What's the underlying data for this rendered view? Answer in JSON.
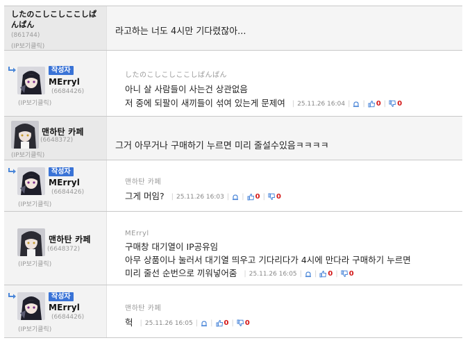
{
  "comments": [
    {
      "nick": "したのこしこしここしぱんぱん",
      "uid": "(861744)",
      "ip": "(IP보기클릭)",
      "content": "라고하는 너도 4시만 기다렸잖아..."
    },
    {
      "badge": "작성자",
      "nick": "MErryl",
      "uid": "(6684426)",
      "ip": "(IP보기클릭)",
      "reply_to": "したのこしこしここしぱんぱん",
      "lines": [
        "아니 살 사람들이 사는건 상관없음",
        "저 중에 되팔이 새끼들이 섞여 있는게 문제여"
      ],
      "time": "25.11.26 16:04",
      "up": "0",
      "down": "0"
    },
    {
      "nick": "맨하탄 카페",
      "uid": "(6648372)",
      "ip": "(IP보기클릭)",
      "content": "그거 아무거나 구매하기 누르면 미리 줄설수있음ㅋㅋㅋㅋ"
    },
    {
      "badge": "작성자",
      "nick": "MErryl",
      "uid": "(6684426)",
      "ip": "(IP보기클릭)",
      "reply_to": "맨하탄 카페",
      "lines": [
        "그게 머임?"
      ],
      "time": "25.11.26 16:03",
      "up": "0",
      "down": "0"
    },
    {
      "nick": "맨하탄 카페",
      "uid": "(6648372)",
      "ip": "(IP보기클릭)",
      "reply_to": "MErryl",
      "lines": [
        "구매창 대기열이 IP공유임",
        "아무 상품이나 눌러서 대기열 띄우고 기다리다가 4시에 만다라 구매하기 누르면",
        "미리 줄선 순번으로 끼워넣어줌"
      ],
      "time": "25.11.26 16:05",
      "up": "0",
      "down": "0"
    },
    {
      "badge": "작성자",
      "nick": "MErryl",
      "uid": "(6684426)",
      "ip": "(IP보기클릭)",
      "reply_to": "맨하탄 카페",
      "lines": [
        "헉"
      ],
      "time": "25.11.26 16:05",
      "up": "0",
      "down": "0"
    }
  ],
  "colors": {
    "badge": "#3a73d6",
    "vote_count": "#d31717",
    "reply_arrow": "#4a86d8"
  },
  "icons": {
    "reply": "reply-arrow-icon",
    "report": "report-bell-icon",
    "upvote": "thumbs-up-icon",
    "downvote": "thumbs-down-icon"
  }
}
